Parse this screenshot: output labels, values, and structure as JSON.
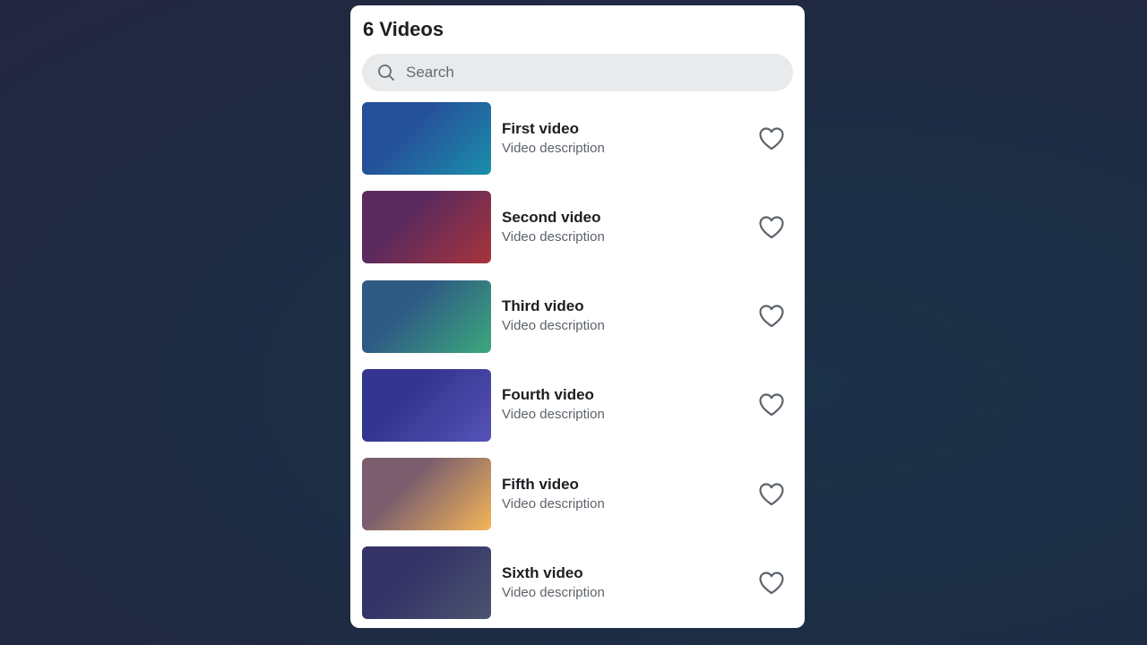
{
  "header": {
    "title": "6 Videos"
  },
  "search": {
    "placeholder": "Search",
    "icon": "search-icon"
  },
  "videos": [
    {
      "title": "First video",
      "description": "Video description",
      "gradient": [
        "#25509a",
        "#1a8eab"
      ],
      "like_icon": "heart-outline-icon"
    },
    {
      "title": "Second video",
      "description": "Video description",
      "gradient": [
        "#5b2a5e",
        "#a8343a"
      ],
      "like_icon": "heart-outline-icon"
    },
    {
      "title": "Third video",
      "description": "Video description",
      "gradient": [
        "#2f5a84",
        "#3ba97c"
      ],
      "like_icon": "heart-outline-icon"
    },
    {
      "title": "Fourth video",
      "description": "Video description",
      "gradient": [
        "#34358f",
        "#5553b8"
      ],
      "like_icon": "heart-outline-icon"
    },
    {
      "title": "Fifth video",
      "description": "Video description",
      "gradient": [
        "#7a5e6e",
        "#f5b557"
      ],
      "like_icon": "heart-outline-icon"
    },
    {
      "title": "Sixth video",
      "description": "Video description",
      "gradient": [
        "#343267",
        "#4a546e"
      ],
      "like_icon": "heart-outline-icon"
    }
  ],
  "colors": {
    "panel": "#ffffff",
    "search_bg": "#e9eaec",
    "text": "#1c1e21",
    "muted": "#5d636b"
  }
}
